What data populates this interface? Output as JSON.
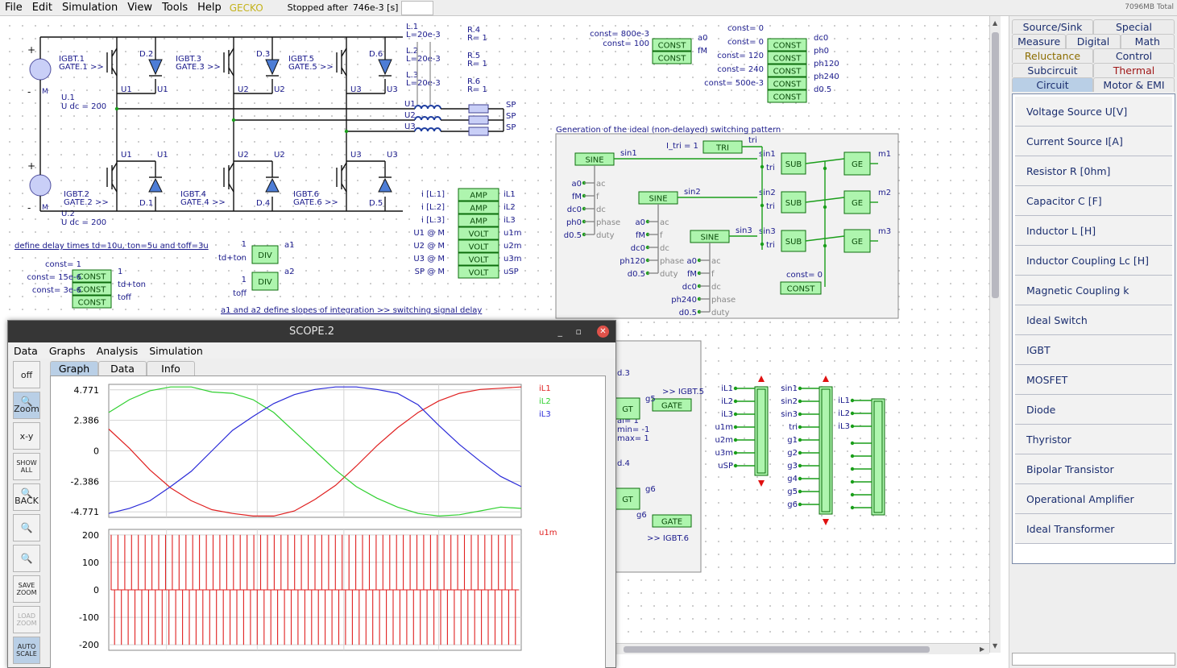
{
  "menubar": {
    "items": [
      "File",
      "Edit",
      "Simulation",
      "View",
      "Tools",
      "Help"
    ],
    "brand": "GECKO",
    "status": "Stopped after",
    "sim_time": "746e-3 [s]",
    "memory": "7096MB Total"
  },
  "palette": {
    "tab_rows": [
      [
        {
          "label": "Source/Sink"
        },
        {
          "label": "Special"
        }
      ],
      [
        {
          "label": "Measure"
        },
        {
          "label": "Digital"
        },
        {
          "label": "Math"
        }
      ],
      [
        {
          "label": "Reluctance",
          "color": "#8c6d00"
        },
        {
          "label": "Control",
          "color": "#1a2d6e"
        }
      ],
      [
        {
          "label": "Subcircuit",
          "color": "#1a2d6e"
        },
        {
          "label": "Thermal",
          "color": "#a01818"
        }
      ],
      [
        {
          "label": "Circuit",
          "selected": true
        },
        {
          "label": "Motor & EMI"
        }
      ]
    ],
    "items": [
      "Voltage Source U[V]",
      "Current Source I[A]",
      "Resistor R [0hm]",
      "Capacitor C [F]",
      "Inductor L [H]",
      "Inductor Coupling Lc [H]",
      "Magnetic Coupling k",
      "Ideal Switch",
      "IGBT",
      "MOSFET",
      "Diode",
      "Thyristor",
      "Bipolar Transistor",
      "Operational Amplifier",
      "Ideal Transformer"
    ]
  },
  "schematic": {
    "sources": [
      {
        "name": "U.1",
        "param": "U dc = 200",
        "pin": "M"
      },
      {
        "name": "U.2",
        "param": "U dc = 200",
        "pin": "M"
      }
    ],
    "igbt_labels": [
      "IGBT.1",
      "GATE.1 >>",
      "IGBT.3",
      "GATE.3 >>",
      "IGBT.5",
      "GATE.5 >>",
      "IGBT.2",
      "GATE.2 >>",
      "IGBT.4",
      "GATE.4 >>",
      "IGBT.6",
      "GATE.6 >>"
    ],
    "diode_labels": [
      "D.2",
      "D.3",
      "D.6",
      "D.1",
      "D.4",
      "D.5"
    ],
    "node_labels": [
      "U1",
      "U2",
      "U3"
    ],
    "inductors": [
      "L.1",
      "L=20e-3",
      "L.2",
      "L=20e-3",
      "L.3",
      "L=20e-3"
    ],
    "resistors": [
      "R.4",
      "R= 1",
      "R.5",
      "R= 1",
      "R.6",
      "R= 1"
    ],
    "sp_label": "SP",
    "delay_note": "define delay times td=10u, ton=5u and toff=3u",
    "delay_consts": [
      "const= 1",
      "const= 15e-6",
      "const= 3e-6"
    ],
    "delay_outputs": [
      "1",
      "td+ton",
      "toff"
    ],
    "div_inputs": [
      "1",
      "td+ton",
      "1",
      "toff"
    ],
    "div_outputs": [
      "a1",
      "a2"
    ],
    "slope_note": "a1 and a2 define slopes of integration >> switching signal delay",
    "meas_inputs": [
      "i [L.1]",
      "i [L.2]",
      "i [L.3]",
      "U1 @ M",
      "U2 @ M",
      "U3 @ M",
      "SP @ M"
    ],
    "meas_blocks": [
      "AMP",
      "AMP",
      "AMP",
      "VOLT",
      "VOLT",
      "VOLT",
      "VOLT"
    ],
    "meas_outputs": [
      "iL1",
      "iL2",
      "iL3",
      "u1m",
      "u2m",
      "u3m",
      "uSP"
    ],
    "top_consts": [
      "const= 800e-3",
      "const= 100"
    ],
    "top_const_out": [
      "a0",
      "fM"
    ],
    "right_consts": [
      "const= 0",
      "const= 0",
      "const= 120",
      "const= 240",
      "const= 500e-3"
    ],
    "right_const_out": [
      "dc0",
      "ph0",
      "ph120",
      "ph240",
      "d0.5"
    ],
    "gen_title": "Generation of the ideal (non-delayed) switching pattern",
    "tri_param": "I_tri = 1",
    "sine_ports": [
      "ac",
      "f",
      "dc",
      "phase",
      "duty"
    ],
    "sine_inputs": [
      [
        "a0",
        "fM",
        "dc0",
        "ph0",
        "d0.5"
      ],
      [
        "a0",
        "fM",
        "dc0",
        "ph120",
        "d0.5"
      ],
      [
        "a0",
        "fM",
        "dc0",
        "ph240",
        "d0.5"
      ]
    ],
    "sine_outputs": [
      "sin1",
      "sin2",
      "sin3"
    ],
    "ge_outputs": [
      "m1",
      "m2",
      "m3"
    ],
    "gen_const": "const= 0",
    "lower_left_labels": [
      "d.3",
      "d.4",
      "al= 1",
      "min= -1",
      "max= 1"
    ],
    "gate_links": [
      ">> IGBT.5",
      ">> IGBT.6"
    ],
    "gt_ports": [
      "g5",
      "g6",
      "g6"
    ],
    "mux1_inputs": [
      "iL1",
      "iL2",
      "iL3",
      "u1m",
      "u2m",
      "u3m",
      "uSP"
    ],
    "mux2_inputs": [
      "sin1",
      "sin2",
      "sin3",
      "tri",
      "g1",
      "g2",
      "g3",
      "g4",
      "g5",
      "g6"
    ],
    "mux3_inputs": [
      "iL1",
      "iL2",
      "iL3"
    ],
    "block_names": {
      "const": "CONST",
      "div": "DIV",
      "tri": "TRI",
      "sine": "SINE",
      "sub": "SUB",
      "ge": "GE",
      "gt": "GT",
      "gate": "GATE"
    }
  },
  "scope": {
    "title": "SCOPE.2",
    "menu": [
      "Data",
      "Graphs",
      "Analysis",
      "Simulation"
    ],
    "tools": [
      {
        "label": "off",
        "active": false
      },
      {
        "label": "Zoom",
        "active": true
      },
      {
        "label": "x-y",
        "active": false
      },
      {
        "label": "SHOW ALL",
        "active": false
      },
      {
        "label": "BACK",
        "active": false
      },
      {
        "label": "",
        "active": false
      },
      {
        "label": "",
        "active": false
      },
      {
        "label": "SAVE ZOOM",
        "active": false
      },
      {
        "label": "LOAD ZOOM",
        "active": false,
        "disabled": true
      },
      {
        "label": "AUTO SCALE",
        "active": true
      }
    ],
    "tabs": [
      "Graph",
      "Data",
      "Info"
    ]
  },
  "chart_data": [
    {
      "type": "line",
      "yticks": [
        4.771,
        2.386,
        0,
        -2.386,
        -4.771
      ],
      "ytick_labels": [
        "4.771",
        "2.386",
        "0",
        "-2.386",
        "-4.771"
      ],
      "ylim": [
        -5.2,
        5.2
      ],
      "x": [
        0,
        0.05,
        0.1,
        0.15,
        0.2,
        0.25,
        0.3,
        0.35,
        0.4,
        0.45,
        0.5,
        0.55,
        0.6,
        0.65,
        0.7,
        0.75,
        0.8,
        0.85,
        0.9,
        0.95,
        1.0
      ],
      "grid": true,
      "series": [
        {
          "name": "iL1",
          "color": "#e02020",
          "values": [
            1.7,
            0.2,
            -1.5,
            -2.9,
            -3.9,
            -4.6,
            -4.9,
            -5.1,
            -5.1,
            -4.7,
            -3.8,
            -2.7,
            -1.2,
            0.4,
            1.8,
            3.0,
            3.9,
            4.5,
            4.8,
            4.9,
            5.0
          ]
        },
        {
          "name": "iL2",
          "color": "#30d030",
          "values": [
            3.0,
            4.0,
            4.7,
            5.0,
            5.0,
            4.6,
            4.5,
            4.0,
            3.0,
            1.5,
            0,
            -1.5,
            -2.8,
            -3.7,
            -4.4,
            -4.9,
            -5.1,
            -5.0,
            -4.7,
            -4.4,
            -4.5
          ]
        },
        {
          "name": "iL3",
          "color": "#2a2ad8",
          "values": [
            -4.9,
            -4.5,
            -3.9,
            -2.8,
            -1.6,
            0.0,
            1.6,
            2.7,
            3.7,
            4.4,
            4.8,
            5.0,
            5.0,
            4.8,
            4.5,
            3.6,
            2.0,
            0.5,
            -0.8,
            -2.0,
            -2.8
          ]
        }
      ]
    },
    {
      "type": "line",
      "yticks": [
        200,
        100,
        0,
        -100,
        -200
      ],
      "ytick_labels": [
        "200",
        "100",
        "0",
        "-100",
        "-200"
      ],
      "ylim": [
        -220,
        220
      ],
      "grid": true,
      "series": [
        {
          "name": "u1m",
          "color": "#e02020",
          "pulse_count": 120,
          "levels": [
            -200,
            0,
            200
          ]
        }
      ]
    }
  ]
}
